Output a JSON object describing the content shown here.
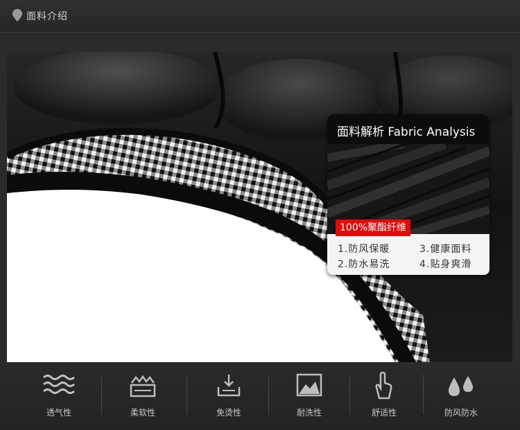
{
  "header": {
    "title": "面料介绍"
  },
  "card": {
    "title": "面料解析 Fabric Analysis",
    "badge": "100%聚酯纤维",
    "features": [
      "1.防风保暖",
      "3.健康面料",
      "2.防水易洗",
      "4.贴身爽滑"
    ]
  },
  "properties": [
    {
      "label": "透气性",
      "icon": "waves-icon"
    },
    {
      "label": "柔软性",
      "icon": "softness-icon"
    },
    {
      "label": "免烫性",
      "icon": "iron-free-icon"
    },
    {
      "label": "耐洗性",
      "icon": "washable-icon"
    },
    {
      "label": "舒适性",
      "icon": "hand-icon"
    },
    {
      "label": "防风防水",
      "icon": "water-drops-icon"
    }
  ],
  "colors": {
    "accent": "#e50a0a",
    "background": "#2b2b2b"
  }
}
